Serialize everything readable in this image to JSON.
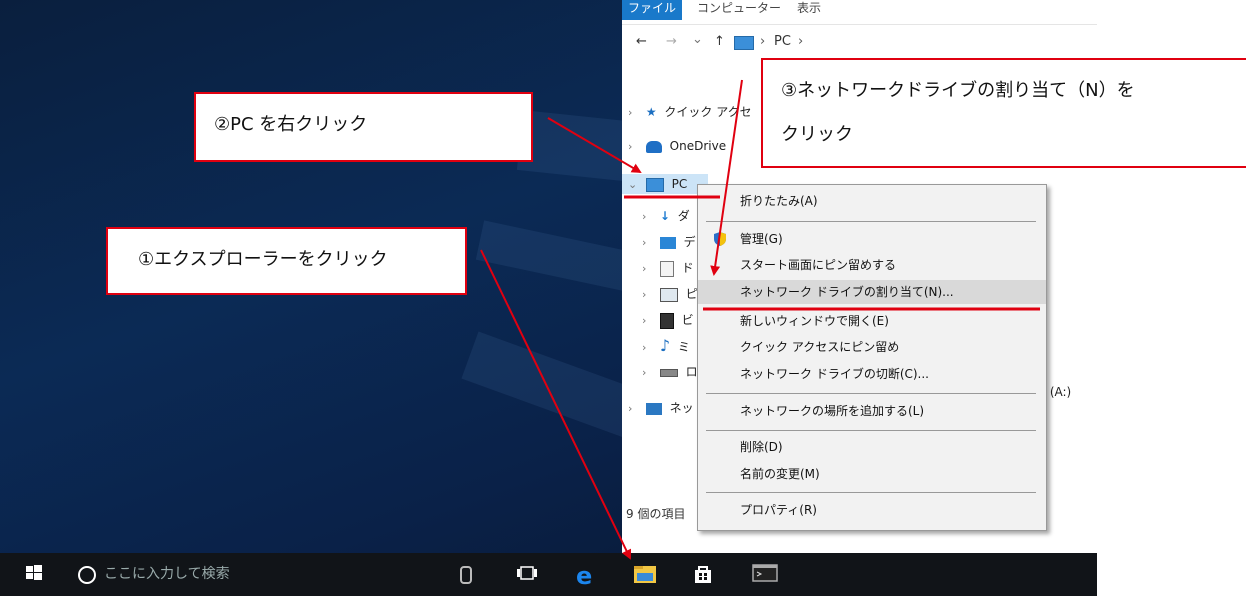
{
  "explorer": {
    "ribbon_tabs": [
      "ファイル",
      "コンピューター",
      "表示"
    ],
    "address": {
      "back": "←",
      "forward": "→",
      "recent": "⌄",
      "up": "↑",
      "path_item": "PC",
      "path_sep": "›"
    },
    "nav": {
      "quick_access": "クイック アクセ",
      "onedrive": "OneDrive",
      "pc": "PC",
      "children": [
        "ダ",
        "デ",
        "ド",
        "ピ",
        "ビ",
        "ミ",
        "ロ"
      ],
      "network": "ネッ"
    },
    "drive_a": "ブ (A:)",
    "status": "9 個の項目"
  },
  "context_menu": {
    "items": [
      "折りたたみ(A)",
      "管理(G)",
      "スタート画面にピン留めする",
      "ネットワーク ドライブの割り当て(N)...",
      "新しいウィンドウで開く(E)",
      "クイック アクセスにピン留め",
      "ネットワーク ドライブの切断(C)...",
      "ネットワークの場所を追加する(L)",
      "削除(D)",
      "名前の変更(M)",
      "プロパティ(R)"
    ],
    "highlighted": "ネットワーク ドライブの割り当て(N)..."
  },
  "taskbar": {
    "search_placeholder": "ここに入力して検索",
    "icons": [
      "windows-start-icon",
      "cortana-icon",
      "microphone-icon",
      "task-view-icon",
      "edge-icon",
      "file-explorer-icon",
      "store-icon",
      "command-prompt-icon"
    ]
  },
  "callouts": {
    "step1": "①エクスプローラーをクリック",
    "step2": "②PC を右クリック",
    "step3_line1": "③ネットワークドライブの割り当て（N）を",
    "step3_line2": "クリック"
  },
  "colors": {
    "annotation_red": "#e00010",
    "ribbon_file_blue": "#1979ca"
  }
}
